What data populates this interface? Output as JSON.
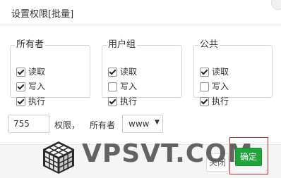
{
  "dialog": {
    "title": "设置权限[批量]"
  },
  "groups": [
    {
      "legend": "所有者",
      "options": [
        {
          "label": "读取",
          "checked": true
        },
        {
          "label": "写入",
          "checked": true
        },
        {
          "label": "执行",
          "checked": true
        }
      ]
    },
    {
      "legend": "用户组",
      "options": [
        {
          "label": "读取",
          "checked": true
        },
        {
          "label": "写入",
          "checked": false
        },
        {
          "label": "执行",
          "checked": true
        }
      ]
    },
    {
      "legend": "公共",
      "options": [
        {
          "label": "读取",
          "checked": true
        },
        {
          "label": "写入",
          "checked": false
        },
        {
          "label": "执行",
          "checked": true
        }
      ]
    }
  ],
  "permission": {
    "value": "755",
    "label": "权限，"
  },
  "owner": {
    "label": "所有者",
    "selected": "www",
    "caret": "▼"
  },
  "footer": {
    "cancel_label": "关闭",
    "confirm_label": "确定"
  },
  "watermark": {
    "text": "VPSVT.COM"
  },
  "colors": {
    "accent": "#20a53a",
    "highlight": "#d9201f"
  }
}
